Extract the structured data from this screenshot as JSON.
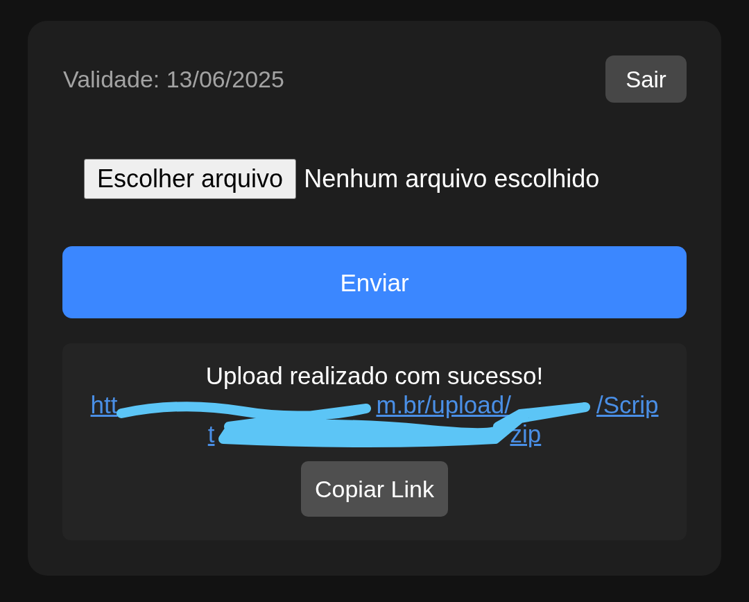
{
  "header": {
    "validity": "Validade: 13/06/2025",
    "logout_button": "Sair"
  },
  "file_input": {
    "button": "Escolher arquivo",
    "status": "Nenhum arquivo escolhido"
  },
  "submit_button": "Enviar",
  "result": {
    "message": "Upload realizado com sucesso!",
    "link": {
      "scribbled": true,
      "lines": [
        {
          "fragments": [
            "htt",
            "m.br/upload/",
            "/Scrip"
          ]
        },
        {
          "fragments": [
            "t",
            "zip"
          ]
        }
      ]
    },
    "copy_button": "Copiar Link"
  }
}
